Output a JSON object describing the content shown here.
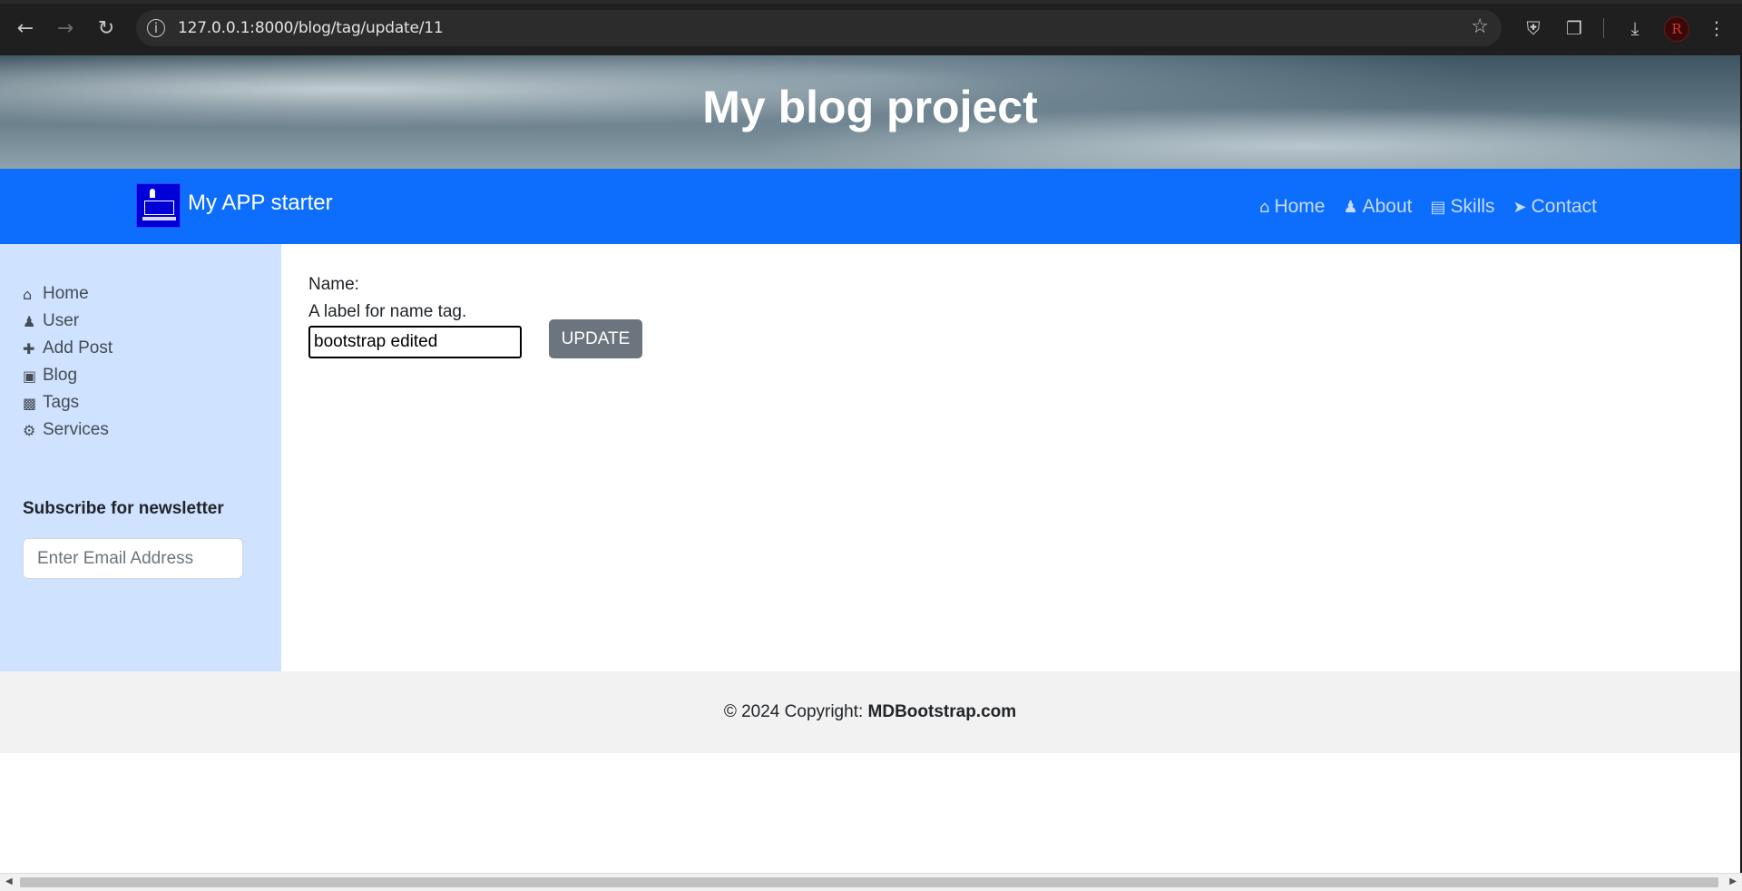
{
  "browser": {
    "url": "127.0.0.1:8000/blog/tag/update/11",
    "icons": [
      "back-arrow-icon",
      "forward-arrow-icon",
      "reload-icon",
      "site-info-icon",
      "bookmark-star-icon",
      "shield-extension-icon",
      "extensions-puzzle-icon",
      "download-icon",
      "profile-avatar",
      "menu-dots-icon"
    ],
    "profile_initial": "R"
  },
  "hero": {
    "title": "My blog project"
  },
  "navbar": {
    "brand": "My APP starter",
    "links": [
      {
        "label": "Home",
        "icon": "home-icon"
      },
      {
        "label": "About",
        "icon": "user-icon"
      },
      {
        "label": "Skills",
        "icon": "book-icon"
      },
      {
        "label": "Contact",
        "icon": "paper-plane-icon"
      }
    ],
    "color": "#0d6efd"
  },
  "sidebar": {
    "items": [
      {
        "label": "Home",
        "icon": "home-icon"
      },
      {
        "label": "User",
        "icon": "user-icon"
      },
      {
        "label": "Add Post",
        "icon": "plus-icon"
      },
      {
        "label": "Blog",
        "icon": "note-icon"
      },
      {
        "label": "Tags",
        "icon": "briefcase-icon"
      },
      {
        "label": "Services",
        "icon": "gears-icon"
      }
    ],
    "newsletter_title": "Subscribe for newsletter",
    "email_placeholder": "Enter Email Address",
    "color": "#cfe2ff"
  },
  "form": {
    "label": "Name:",
    "help_text": "A label for name tag.",
    "name_value": "bootstrap edited",
    "submit_label": "UPDATE"
  },
  "footer": {
    "copyright_prefix": "© 2024 Copyright: ",
    "copyright_site": "MDBootstrap.com"
  }
}
